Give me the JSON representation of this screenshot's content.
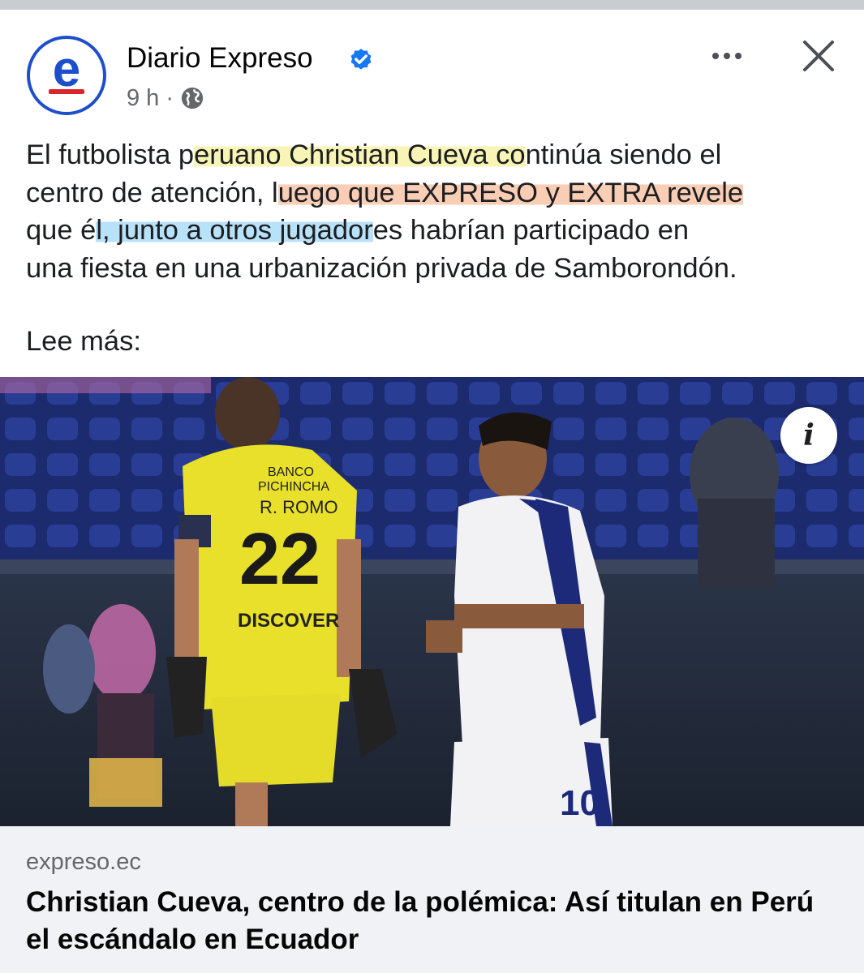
{
  "post": {
    "page_name": "Diario Expreso",
    "avatar_letter": "e",
    "time": "9 h",
    "separator": "·",
    "text_lines": [
      [
        "El futbolista p",
        "eruano Christian Cueva co",
        "ntinúa siendo el"
      ],
      [
        "centro de atención, l",
        "uego que EXPRESO y EXTRA revele",
        ""
      ],
      [
        "que é",
        "l, junto a otros jugador",
        "es habrían participado en"
      ],
      [
        "una fiesta en una urbanización privada de Samborondón."
      ]
    ],
    "read_more": "Lee más:"
  },
  "image": {
    "player_left_name": "R. ROMO",
    "player_left_number": "22",
    "sponsor_top": "BANCO",
    "sponsor_bottom": "PICHINCHA",
    "sponsor_chest": "DISCOVER",
    "player_right_number": "10",
    "info_glyph": "i"
  },
  "link_preview": {
    "domain": "expreso.ec",
    "title": "Christian Cueva, centro de la polémica: Así titulan en Perú el escándalo en Ecuador"
  },
  "colors": {
    "brand_blue": "#1d4fcc",
    "brand_red": "#d9262c",
    "verified_blue": "#1877f2",
    "highlight_yellow": "#f2ec78",
    "highlight_orange": "#f6a478",
    "highlight_blue": "#7ec8f6"
  },
  "icons": [
    "verified-badge-icon",
    "globe-icon",
    "more-options-icon",
    "close-icon",
    "info-icon"
  ]
}
